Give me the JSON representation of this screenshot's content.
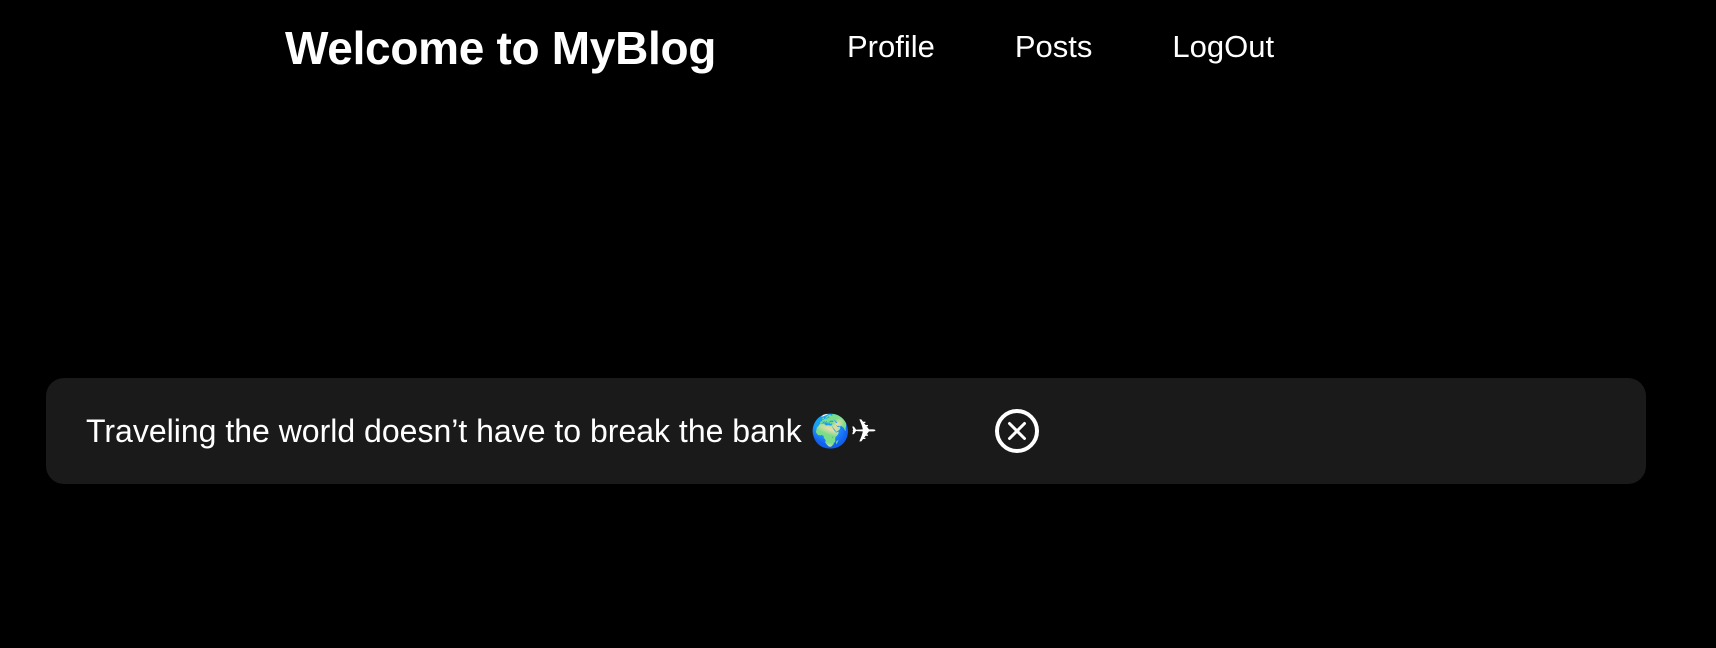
{
  "header": {
    "title": "Welcome to MyBlog",
    "nav": [
      {
        "label": "Profile"
      },
      {
        "label": "Posts"
      },
      {
        "label": "LogOut"
      }
    ]
  },
  "post": {
    "text": "Traveling the world doesn’t have to break the bank",
    "emoji": "🌍✈",
    "close_icon": "close-circle-icon"
  },
  "colors": {
    "background": "#000000",
    "card": "#1a1a1a",
    "text": "#ffffff"
  }
}
